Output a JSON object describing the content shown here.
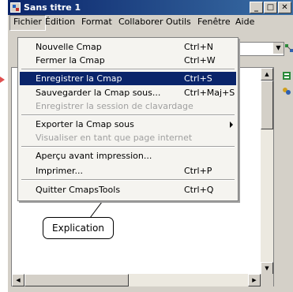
{
  "window": {
    "title": "Sans titre 1",
    "controls": {
      "minimize": "_",
      "maximize": "□",
      "close": "✕"
    }
  },
  "menubar": {
    "items": [
      "Fichier",
      "Édition",
      "Format",
      "Collaborer",
      "Outils",
      "Fenêtre",
      "Aide"
    ],
    "active_index": 0
  },
  "file_menu": {
    "items": [
      {
        "label": "Nouvelle Cmap",
        "shortcut": "Ctrl+N",
        "enabled": true
      },
      {
        "label": "Fermer la Cmap",
        "shortcut": "Ctrl+W",
        "enabled": true
      },
      {
        "label": "Enregistrer la Cmap",
        "shortcut": "Ctrl+S",
        "enabled": true,
        "highlighted": true
      },
      {
        "label": "Sauvegarder la Cmap sous...",
        "shortcut": "Ctrl+Maj+S",
        "enabled": true
      },
      {
        "label": "Enregistrer la session de clavardage",
        "shortcut": "",
        "enabled": false
      },
      {
        "label": "Exporter la Cmap sous",
        "shortcut": "",
        "enabled": true,
        "submenu": true
      },
      {
        "label": "Visualiser en tant que page internet",
        "shortcut": "",
        "enabled": false
      },
      {
        "label": "Aperçu avant impression...",
        "shortcut": "",
        "enabled": true
      },
      {
        "label": "Imprimer...",
        "shortcut": "Ctrl+P",
        "enabled": true
      },
      {
        "label": "Quitter CmapsTools",
        "shortcut": "Ctrl+Q",
        "enabled": true
      }
    ]
  },
  "canvas": {
    "concept_label": "Explication"
  },
  "colors": {
    "title_bar": "#0a246a",
    "highlight": "#0a246a",
    "chrome": "#d4d0c8"
  }
}
